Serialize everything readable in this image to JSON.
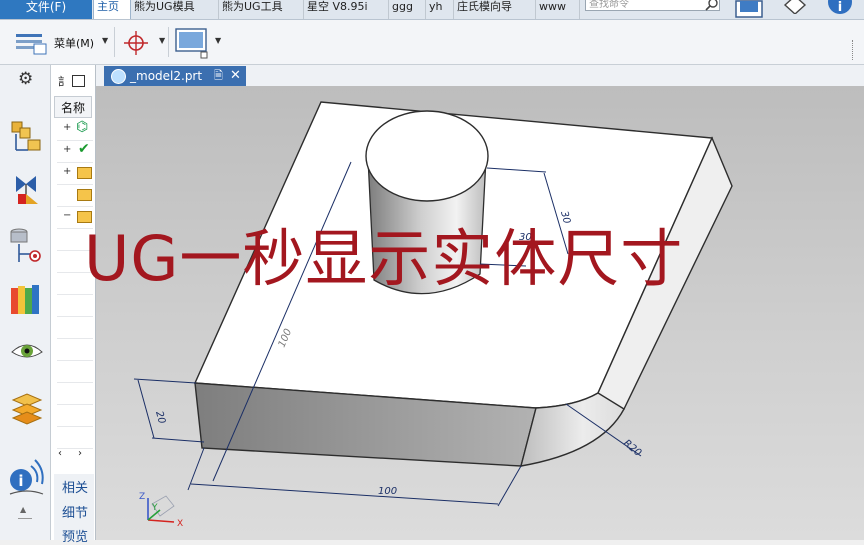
{
  "ribbon": {
    "file_label": "文件(F)",
    "tabs": [
      "主页",
      "熊为UG模具",
      "熊为UG工具",
      "星空 V8.95i",
      "ggg",
      "yh",
      "庄氏模向导",
      "www"
    ],
    "search_placeholder": "查找命令"
  },
  "toolbar": {
    "menu_label": "菜单(M)"
  },
  "navigator": {
    "column_header": "名称",
    "bottom_items": [
      "相关",
      "细节",
      "预览"
    ]
  },
  "document": {
    "tab_label": "_model2.prt"
  },
  "viewport": {
    "overlay_title": "UG一秒显示实体尺寸",
    "dimensions": {
      "height": "20",
      "width_bottom": "100",
      "depth_diagonal": "100",
      "cylinder_height": "30",
      "cylinder_diameter": "30",
      "corner_radius": "R20"
    },
    "triad": {
      "x": "X",
      "y": "Y",
      "z": "Z"
    }
  },
  "colors": {
    "file_tab": "#2f78c0",
    "doc_tab": "#3b6fb0",
    "overlay_text": "#a3171f",
    "dimension_lines": "#1b2f66"
  }
}
